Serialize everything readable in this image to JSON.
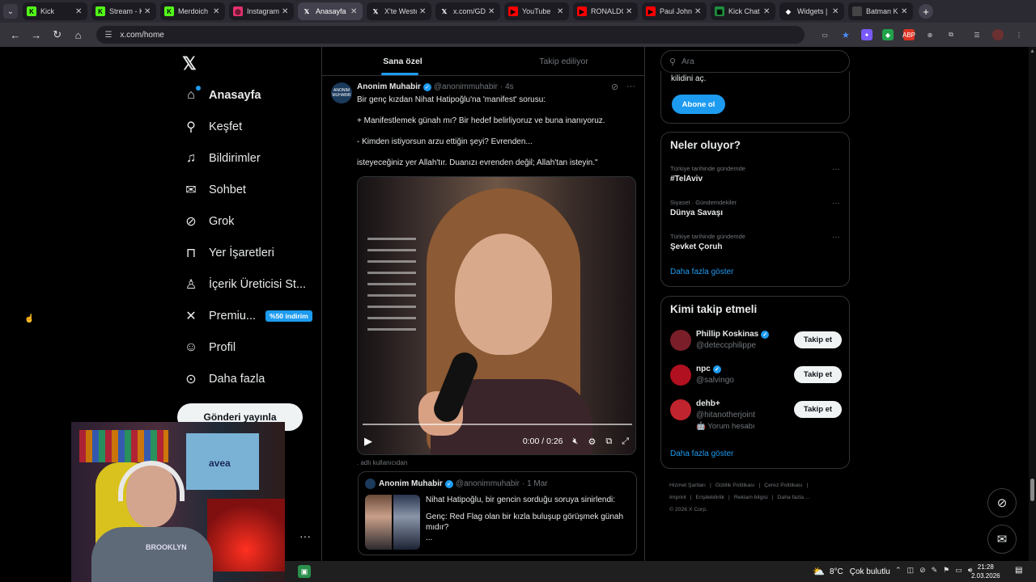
{
  "browser": {
    "tabs": [
      {
        "label": "Kick",
        "icon": "kick-icon",
        "color": "#53fc18",
        "glyph": "K"
      },
      {
        "label": "Stream - K",
        "icon": "kick-icon",
        "color": "#53fc18",
        "glyph": "K"
      },
      {
        "label": "Merdoich",
        "icon": "kick-icon",
        "color": "#53fc18",
        "glyph": "K"
      },
      {
        "label": "Instagram",
        "icon": "instagram-icon",
        "color": "#e1306c",
        "glyph": "◎"
      },
      {
        "label": "Anasayfa",
        "icon": "x-icon",
        "color": "#ffffff",
        "glyph": "𝕏",
        "active": true
      },
      {
        "label": "X'te Weste",
        "icon": "x-icon",
        "color": "#ffffff",
        "glyph": "𝕏"
      },
      {
        "label": "x.com/GD",
        "icon": "x-icon",
        "color": "#ffffff",
        "glyph": "𝕏"
      },
      {
        "label": "YouTube",
        "icon": "youtube-icon",
        "color": "#ff0000",
        "glyph": "▶"
      },
      {
        "label": "RONALDO",
        "icon": "youtube-icon",
        "color": "#ff0000",
        "glyph": "▶"
      },
      {
        "label": "Paul Johns",
        "icon": "youtube-icon",
        "color": "#ff0000",
        "glyph": "▶"
      },
      {
        "label": "Kick Chat",
        "icon": "sheet-icon",
        "color": "#1e8e3e",
        "glyph": "▦"
      },
      {
        "label": "Widgets |",
        "icon": "widgets-icon",
        "color": "#ffffff",
        "glyph": "◆"
      },
      {
        "label": "Batman K",
        "icon": "blank-icon",
        "color": "#444444",
        "glyph": ""
      }
    ],
    "url": "x.com/home"
  },
  "nav": {
    "items": [
      {
        "label": "Anasayfa",
        "icon": "home-icon",
        "glyph": "⌂",
        "bold": true,
        "dot": true
      },
      {
        "label": "Keşfet",
        "icon": "search-icon",
        "glyph": "⚲"
      },
      {
        "label": "Bildirimler",
        "icon": "bell-icon",
        "glyph": "♫"
      },
      {
        "label": "Sohbet",
        "icon": "mail-icon",
        "glyph": "✉"
      },
      {
        "label": "Grok",
        "icon": "grok-icon",
        "glyph": "⊘"
      },
      {
        "label": "Yer İşaretleri",
        "icon": "bookmark-icon",
        "glyph": "⊓"
      },
      {
        "label": "İçerik Üreticisi St...",
        "icon": "creator-icon",
        "glyph": "♙"
      },
      {
        "label": "Premiu...",
        "icon": "x-premium-icon",
        "glyph": "✕",
        "promo": "%50 indirim"
      },
      {
        "label": "Profil",
        "icon": "profile-icon",
        "glyph": "☺"
      },
      {
        "label": "Daha fazla",
        "icon": "more-circle-icon",
        "glyph": "⊙"
      }
    ],
    "post_button": "Gönderi yayınla",
    "more": "···"
  },
  "webcam": {
    "poster_text": "avea",
    "shirt_text": "BROOKLYN"
  },
  "feed": {
    "tabs": [
      "Sana özel",
      "Takip ediliyor"
    ],
    "tweet": {
      "author": "Anonim Muhabir",
      "handle": "@anonimmuhabir",
      "time": "· 4s",
      "avatar_text": "ANONIM MUHABIR",
      "lines": [
        "Bir genç kızdan Nihat Hatipoğlu'na 'manifest' sorusu:",
        "+ Manifestlemek günah mı? Bir hedef belirliyoruz ve buna inanıyoruz.",
        "- Kimden istiyorsun arzu ettiğin şeyi? Evrenden...",
        "isteyeceğiniz yer Allah'tır. Duanızı evrenden değil; Allah'tan isteyin.\""
      ],
      "video_time": "0:00 / 0:26",
      "video_progress": 0
    },
    "reply_note": ". adlı kullanıcıdan",
    "quote": {
      "author": "Anonim Muhabir",
      "handle": "@anonimmuhabir",
      "time": "· 1 Mar",
      "lines": [
        "Nihat Hatipoğlu, bir gencin sorduğu soruya sinirlendi:",
        "Genç: Red Flag olan bir kızla buluşup görüşmek günah mıdır?",
        "..."
      ]
    }
  },
  "right": {
    "search_placeholder": "Ara",
    "subscribe": {
      "text": "kilidini aç.",
      "button": "Abone ol"
    },
    "trends": {
      "title": "Neler oluyor?",
      "items": [
        {
          "context": "Türkiye tarihinde gündemde",
          "topic": "#TelAviv"
        },
        {
          "context": "Siyaset · Gündemdekiler",
          "topic": "Dünya Savaşı"
        },
        {
          "context": "Türkiye tarihinde gündemde",
          "topic": "Şevket Çoruh"
        }
      ],
      "show_more": "Daha fazla göster"
    },
    "who_to_follow": {
      "title": "Kimi takip etmeli",
      "items": [
        {
          "name": "Phillip Koskinas",
          "handle": "@deteccphilippe",
          "verified": true,
          "avatar_color": "#7a1f2a"
        },
        {
          "name": "npc",
          "handle": "@salvingo",
          "verified": true,
          "avatar_color": "#b01020"
        },
        {
          "name": "dehb+",
          "handle": "@hitanotherjoint",
          "verified": false,
          "extra": "🤖 Yorum hesabı",
          "avatar_color": "#c0242e"
        }
      ],
      "follow_label": "Takip et",
      "show_more": "Daha fazla göster"
    },
    "footer": [
      "Hizmet Şartları",
      "|",
      "Gizlilik Politikası",
      "|",
      "Çerez Politikası",
      "|",
      "Imprint",
      "|",
      "Erişilebilirlik",
      "|",
      "Reklam bilgisi",
      "|",
      "Daha fazla ...",
      "© 2026 X Corp."
    ]
  },
  "taskbar": {
    "weather_temp": "8°C",
    "weather_text": "Çok bulutlu",
    "time": "21:28",
    "date": "2.03.2026"
  },
  "colors": {
    "accent": "#1d9bf0",
    "background": "#000000",
    "border": "#2f3336"
  }
}
